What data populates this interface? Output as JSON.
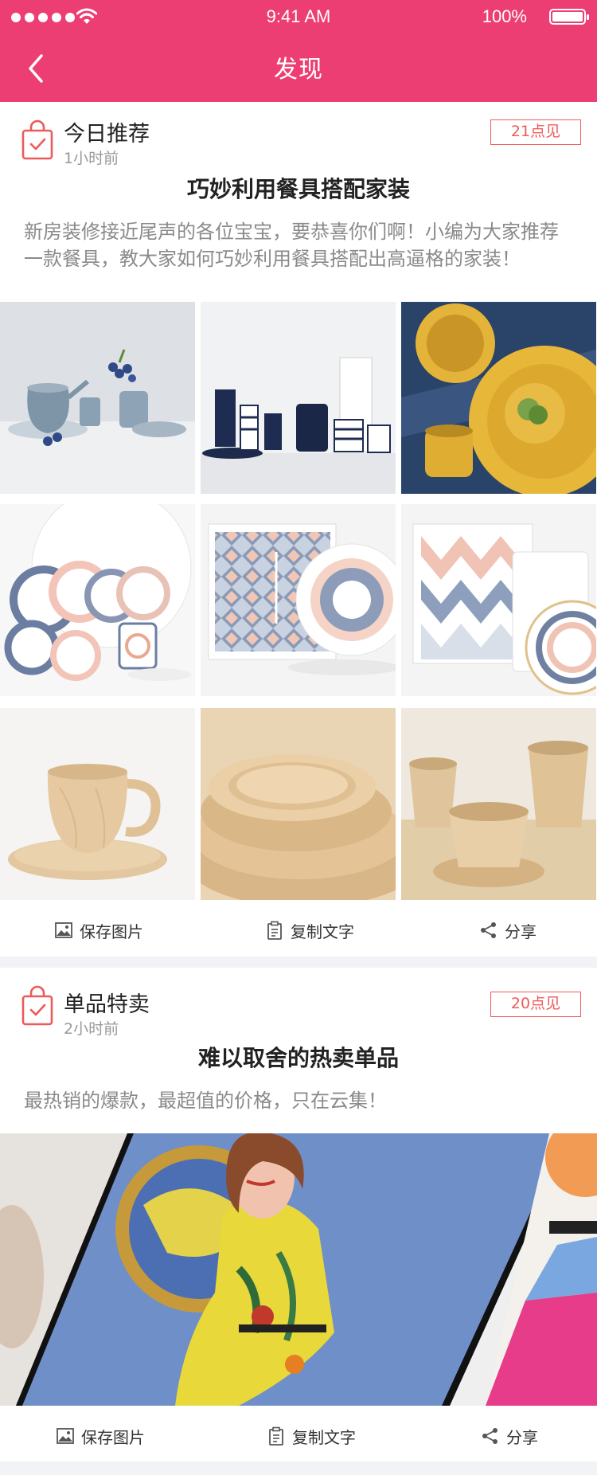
{
  "status_bar": {
    "time": "9:41 AM",
    "battery": "100%"
  },
  "nav": {
    "title": "发现"
  },
  "posts": [
    {
      "tag": "今日推荐",
      "time": "1小时前",
      "badge": "21点见",
      "title": "巧妙利用餐具搭配家装",
      "desc": "新房装修接近尾声的各位宝宝，要恭喜你们啊！小编为大家推荐一款餐具，教大家如何巧妙利用餐具搭配出高逼格的家装！",
      "actions": {
        "save": "保存图片",
        "copy": "复制文字",
        "share": "分享"
      }
    },
    {
      "tag": "单品特卖",
      "time": "2小时前",
      "badge": "20点见",
      "title": "难以取舍的热卖单品",
      "desc": "最热销的爆款，最超值的价格，只在云集！",
      "actions": {
        "save": "保存图片",
        "copy": "复制文字",
        "share": "分享"
      }
    }
  ],
  "colors": {
    "brand": "#ec3e73",
    "badge": "#f05a5a"
  },
  "icons": [
    "back-chevron-icon",
    "shopping-bag-icon",
    "image-icon",
    "clipboard-icon",
    "share-icon"
  ]
}
